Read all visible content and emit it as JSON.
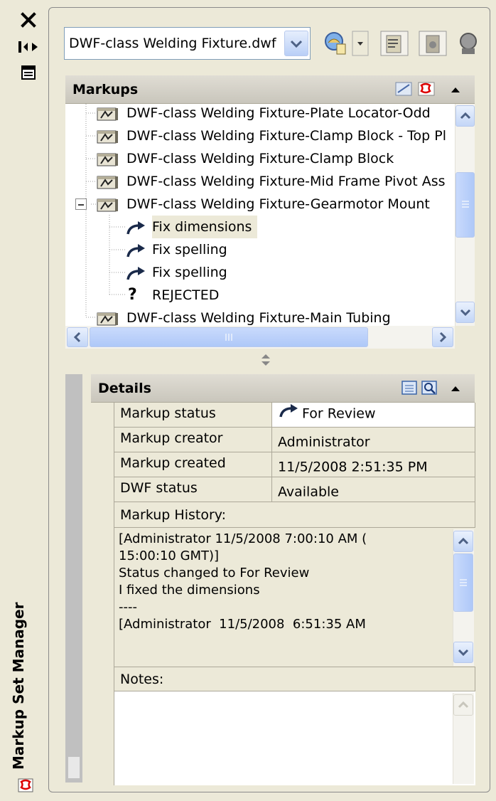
{
  "palette": {
    "title": "Markup Set Manager",
    "close_icon": "close-icon",
    "autohide_icon": "auto-hide-icon",
    "properties_icon": "properties-icon"
  },
  "toolbar": {
    "file_select_value": "DWF-class Welding Fixture.dwf",
    "icons": [
      "open-markup-icon",
      "republish-icon",
      "view-dwf-icon",
      "hide-markups-icon"
    ]
  },
  "markups": {
    "title": "Markups",
    "header_icons": [
      "view-redline-icon",
      "markup-set-icon",
      "collapse-icon"
    ],
    "rows": [
      {
        "label": "DWF-class Welding Fixture-Plate Locator-Odd",
        "icon": "sheet-icon",
        "level": 0,
        "expander": false
      },
      {
        "label": "DWF-class Welding Fixture-Clamp Block - Top Pl",
        "icon": "sheet-icon",
        "level": 0,
        "expander": false
      },
      {
        "label": "DWF-class Welding Fixture-Clamp Block",
        "icon": "sheet-icon",
        "level": 0,
        "expander": false
      },
      {
        "label": "DWF-class Welding Fixture-Mid Frame Pivot Ass",
        "icon": "sheet-icon",
        "level": 0,
        "expander": false
      },
      {
        "label": "DWF-class Welding Fixture-Gearmotor Mount",
        "icon": "sheet-icon",
        "level": 0,
        "expander": true
      },
      {
        "label": "Fix dimensions",
        "icon": "for-review-arrow-icon",
        "level": 1,
        "selected": true
      },
      {
        "label": "Fix spelling",
        "icon": "for-review-arrow-icon",
        "level": 1
      },
      {
        "label": "Fix spelling",
        "icon": "for-review-arrow-icon",
        "level": 1
      },
      {
        "label": "REJECTED",
        "icon": "question-mark-icon",
        "level": 1
      },
      {
        "label": "DWF-class Welding Fixture-Main Tubing",
        "icon": "sheet-icon",
        "level": 0,
        "expander": false
      }
    ]
  },
  "details": {
    "title": "Details",
    "header_icons": [
      "details-view-icon",
      "preview-icon",
      "collapse-icon"
    ],
    "fields": [
      {
        "label": "Markup status",
        "value": "For Review",
        "icon": "for-review-arrow-icon"
      },
      {
        "label": "Markup creator",
        "value": "Administrator"
      },
      {
        "label": "Markup created",
        "value": "11/5/2008 2:51:35 PM"
      },
      {
        "label": "DWF status",
        "value": "Available"
      }
    ],
    "history_label": "Markup History:",
    "history_text": "[Administrator 11/5/2008 7:00:10 AM (\n15:00:10 GMT)]\nStatus changed to For Review\nI fixed the dimensions\n----\n[Administrator  11/5/2008  6:51:35 AM",
    "notes_label": "Notes:",
    "notes_text": ""
  },
  "colors": {
    "panel_bg": "#ece9d8",
    "scrollbar_blue": "#c3d6f7",
    "selection": "#ece9d8"
  }
}
